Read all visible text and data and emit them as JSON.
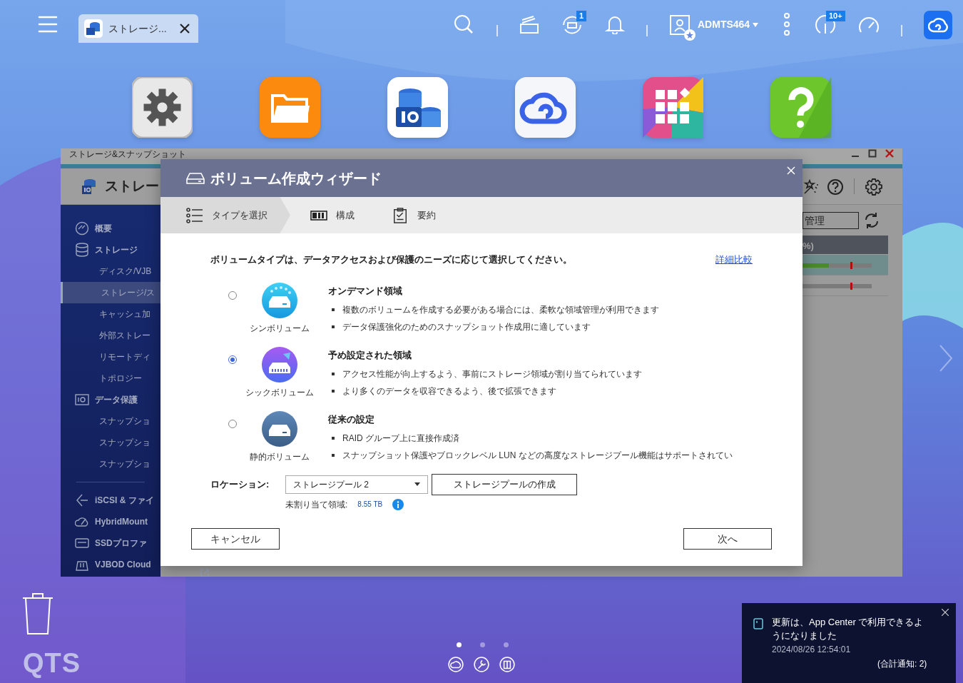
{
  "topbar": {
    "tab": {
      "label": "ストレージ..."
    },
    "sync_badge": "1",
    "user": "ADMTS464",
    "info_badge": "10+"
  },
  "desktop_apps": [
    {
      "kind": "settings"
    },
    {
      "kind": "files"
    },
    {
      "kind": "storage"
    },
    {
      "kind": "cloud"
    },
    {
      "kind": "apps"
    },
    {
      "kind": "help"
    }
  ],
  "storage_window": {
    "title": "ストレージ&スナップショット",
    "header": "ストレー",
    "sidebar": [
      {
        "label": "概要",
        "selected": false
      },
      {
        "label": "ストレージ",
        "selected": false,
        "children": [
          {
            "label": "ディスク/VJB",
            "selected": false
          },
          {
            "label": "ストレージ/ス",
            "selected": true
          },
          {
            "label": "キャッシュ加",
            "selected": false
          },
          {
            "label": "外部ストレー",
            "selected": false
          },
          {
            "label": "リモートディ",
            "selected": false
          },
          {
            "label": "トポロジー",
            "selected": false
          }
        ]
      },
      {
        "label": "データ保護",
        "selected": false,
        "children": [
          {
            "label": "スナップショ",
            "selected": false
          },
          {
            "label": "スナップショ",
            "selected": false
          },
          {
            "label": "スナップショ",
            "selected": false
          }
        ]
      },
      {
        "label": "iSCSI & ファイ",
        "selected": false
      },
      {
        "label": "HybridMount",
        "selected": false
      },
      {
        "label": "SSDプロファ",
        "selected": false
      },
      {
        "label": "VJBOD Cloud",
        "selected": false
      }
    ],
    "filter_field": "管理",
    "column_fragment": "%)",
    "rows": [
      {
        "selected": true,
        "level": 0.38
      },
      {
        "selected": false,
        "level": 0
      }
    ]
  },
  "dialog": {
    "title": "ボリューム作成ウィザード",
    "steps": [
      {
        "label": "タイプを選択",
        "selected": true
      },
      {
        "label": "構成",
        "selected": false
      },
      {
        "label": "要約",
        "selected": false
      }
    ],
    "intro": "ボリュームタイプは、データアクセスおよび保護のニーズに応じて選択してください。",
    "compare_link": "詳細比較",
    "options": [
      {
        "kind": "thin",
        "name": "シンボリューム",
        "heading": "オンデマンド領域",
        "selected": false,
        "bullets": [
          "複数のボリュームを作成する必要がある場合には、柔軟な領域管理が利用できます",
          "データ保護強化のためのスナップショット作成用に適しています"
        ]
      },
      {
        "kind": "thick",
        "name": "シックボリューム",
        "heading": "予め設定された領域",
        "selected": true,
        "bullets": [
          "アクセス性能が向上するよう、事前にストレージ領域が割り当てられています",
          "より多くのデータを収容できるよう、後で拡張できます"
        ]
      },
      {
        "kind": "static",
        "name": "静的ボリューム",
        "heading": "従来の設定",
        "selected": false,
        "bullets": [
          "RAID グループ上に直接作成済",
          "スナップショット保護やブロックレベル LUN などの高度なストレージプール機能はサポートされてい"
        ]
      }
    ],
    "location_label": "ロケーション:",
    "location_value": "ストレージプール 2",
    "create_pool_button": "ストレージプールの作成",
    "unallocated_label": "未割り当て領域:",
    "unallocated_value": "8.55 TB",
    "cancel_button": "キャンセル",
    "next_button": "次へ"
  },
  "dock": {
    "logo": "QTS",
    "pages": [
      {
        "selected": true
      },
      {
        "selected": false
      },
      {
        "selected": false
      }
    ]
  },
  "notification": {
    "message": "更新は、App Center で利用できるようになりました",
    "time": "2024/08/26 12:54:01",
    "total": "(合計通知: 2)"
  }
}
